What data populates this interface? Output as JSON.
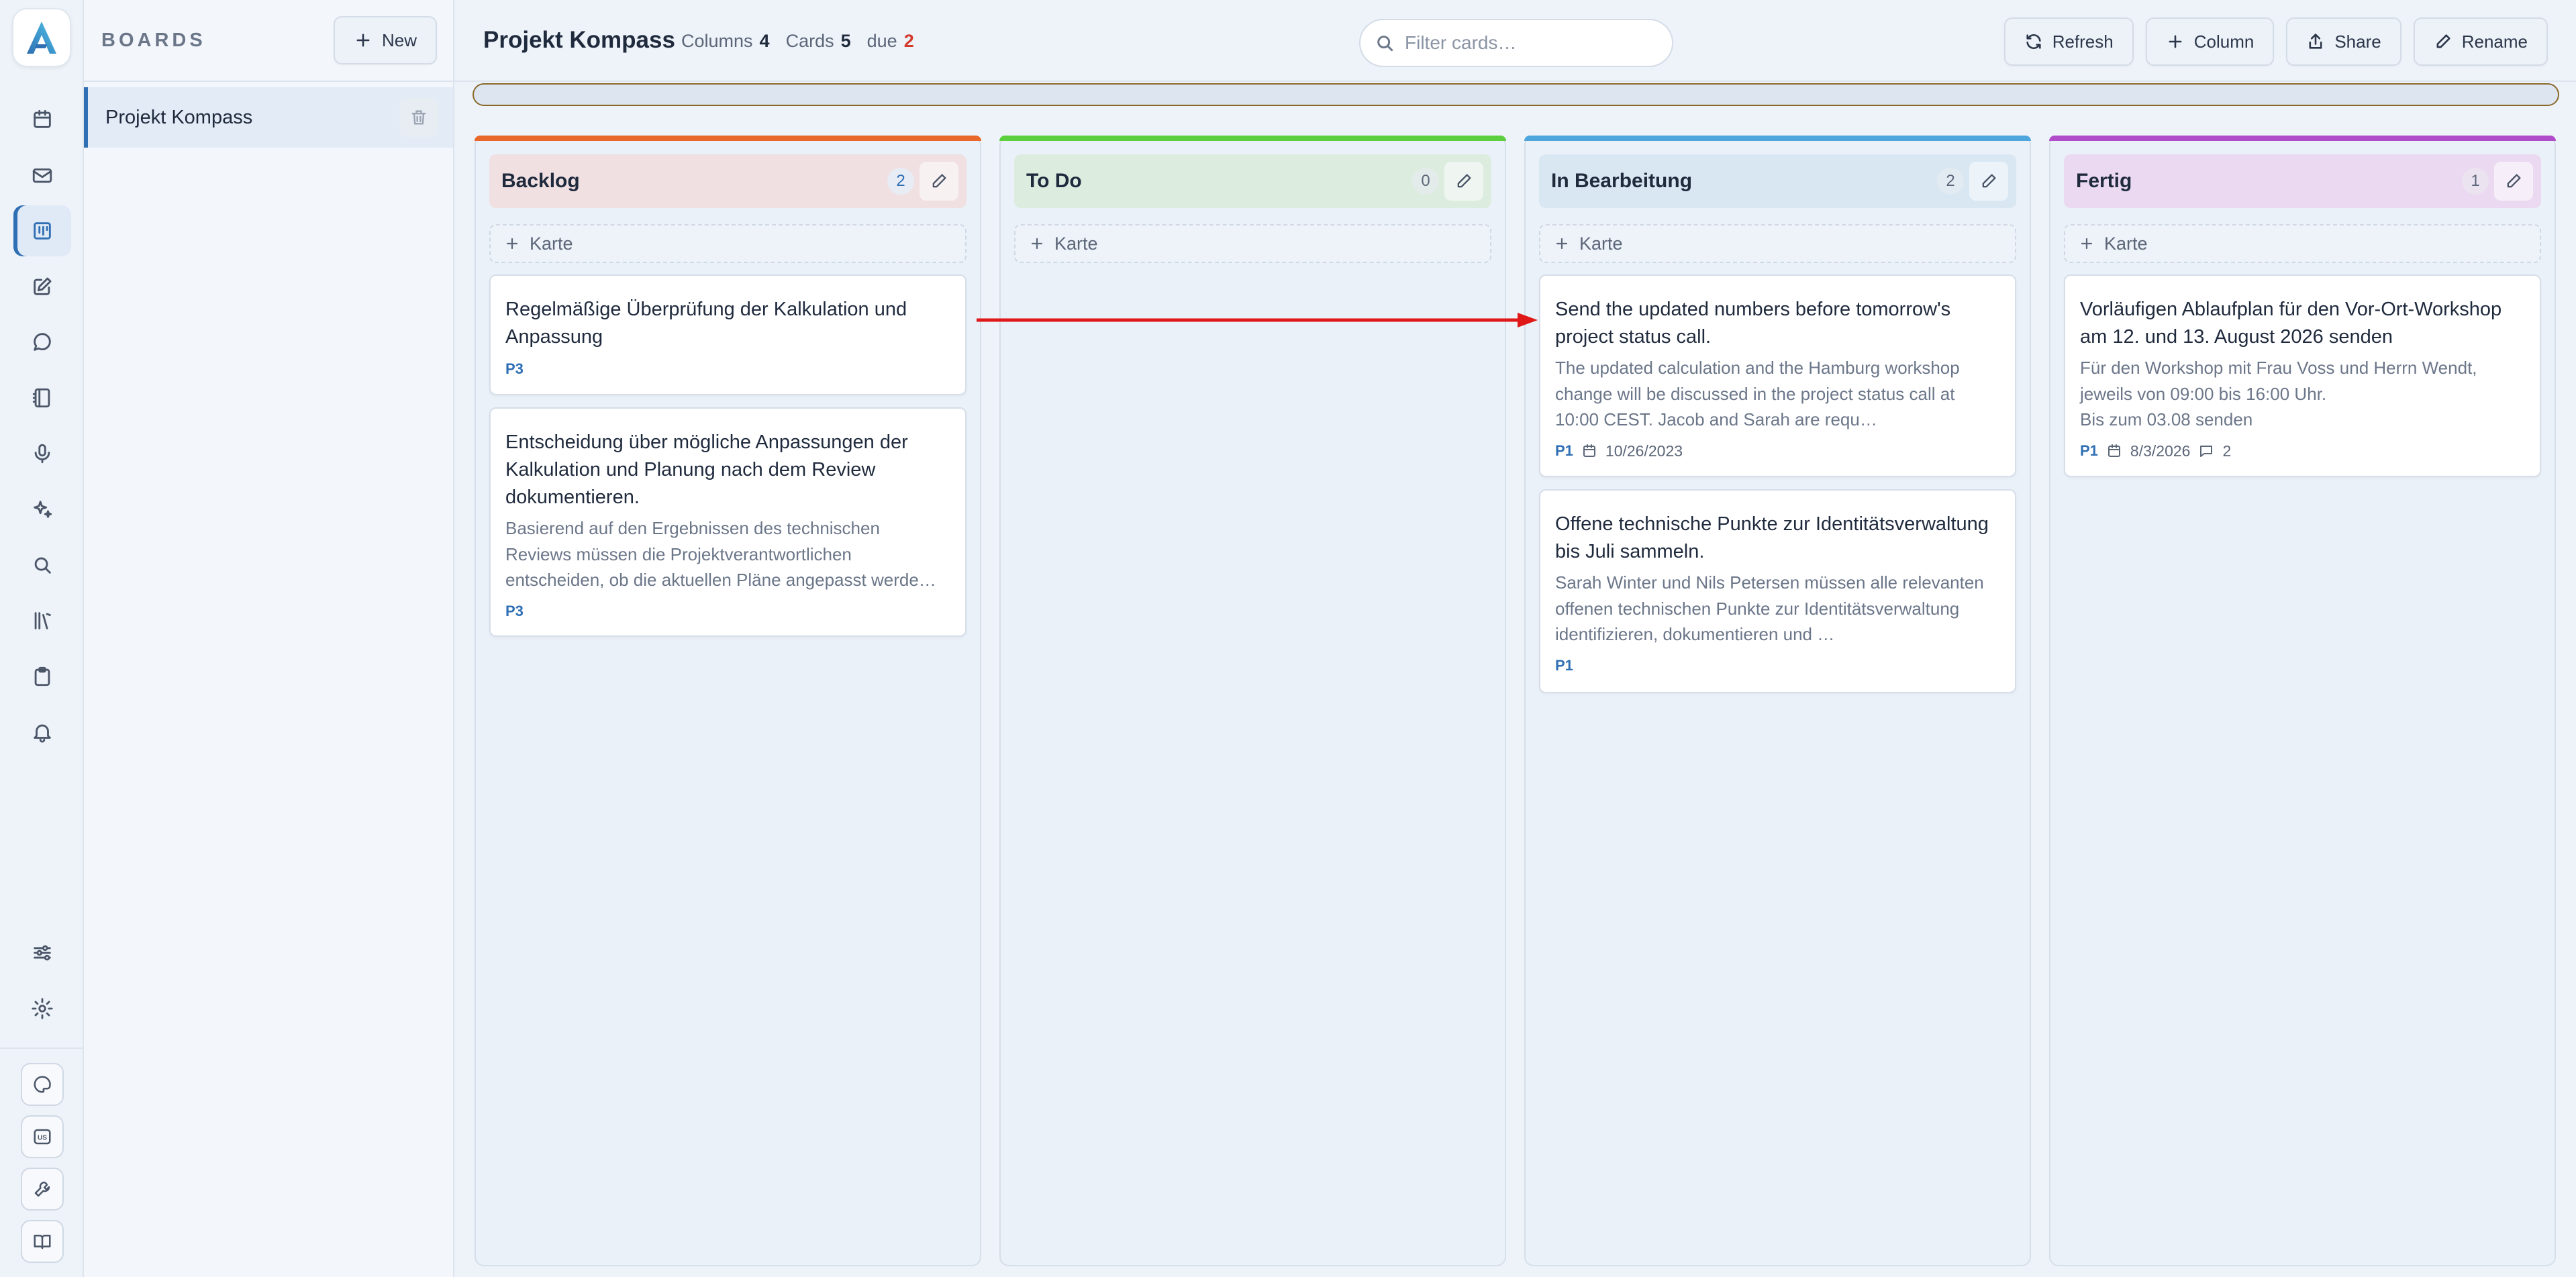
{
  "colors": {
    "accent": "#2f6fb3",
    "due": "#d23b2e",
    "backlog": "#e8672a",
    "todo": "#5ccf3e",
    "in_progress": "#4fa6dc",
    "done": "#b04cc9"
  },
  "sidebar": {
    "title": "BOARDS",
    "new_label": "New",
    "boards": [
      {
        "name": "Projekt Kompass"
      }
    ]
  },
  "rail": {
    "icons": [
      "app-logo",
      "calendar-icon",
      "mail-icon",
      "kanban-icon",
      "edit-icon",
      "chat-icon",
      "notebook-icon",
      "microphone-icon",
      "sparkles-icon",
      "search-icon",
      "library-icon",
      "clipboard-icon",
      "bell-icon",
      "sliders-icon",
      "gear-icon",
      "palette-icon",
      "language-icon",
      "wrench-icon",
      "book-icon"
    ],
    "language_code": "US"
  },
  "header": {
    "title": "Projekt Kompass",
    "columns_label": "Columns",
    "columns_value": "4",
    "cards_label": "Cards",
    "cards_value": "5",
    "due_label": "due",
    "due_value": "2",
    "search_placeholder": "Filter cards…",
    "buttons": {
      "refresh": "Refresh",
      "column": "Column",
      "share": "Share",
      "rename": "Rename"
    }
  },
  "add_card_label": "Karte",
  "columns": [
    {
      "title": "Backlog",
      "count": "2",
      "cards": [
        {
          "title": "Regelmäßige Überprüfung der Kalkulation und Anpassung",
          "description": "",
          "priority": "P3"
        },
        {
          "title": "Entscheidung über mögliche Anpassungen der Kalkulation und Planung nach dem Review dokumentieren.",
          "description": "Basierend auf den Ergebnissen des technischen Reviews müssen die Projektverantwortlichen entscheiden, ob die aktuellen Pläne angepasst werde…",
          "priority": "P3"
        }
      ]
    },
    {
      "title": "To Do",
      "count": "0",
      "cards": []
    },
    {
      "title": "In Bearbeitung",
      "count": "2",
      "cards": [
        {
          "title": "Send the updated numbers before tomorrow's project status call.",
          "description": "The updated calculation and the Hamburg workshop change will be discussed in the project status call at 10:00 CEST. Jacob and Sarah are requ…",
          "priority": "P1",
          "date": "10/26/2023"
        },
        {
          "title": "Offene technische Punkte zur Identitätsverwaltung bis Juli sammeln.",
          "description": "Sarah Winter und Nils Petersen müssen alle relevanten offenen technischen Punkte zur Identitätsverwaltung identifizieren, dokumentieren und …",
          "priority": "P1"
        }
      ]
    },
    {
      "title": "Fertig",
      "count": "1",
      "cards": [
        {
          "title": "Vorläufigen Ablaufplan für den Vor-Ort-Workshop am 12. und 13. August 2026 senden",
          "description": "Für den Workshop mit Frau Voss und Herrn Wendt, jeweils von 09:00 bis 16:00 Uhr.\nBis zum 03.08 senden",
          "priority": "P1",
          "date": "8/3/2026",
          "comments": "2"
        }
      ]
    }
  ]
}
